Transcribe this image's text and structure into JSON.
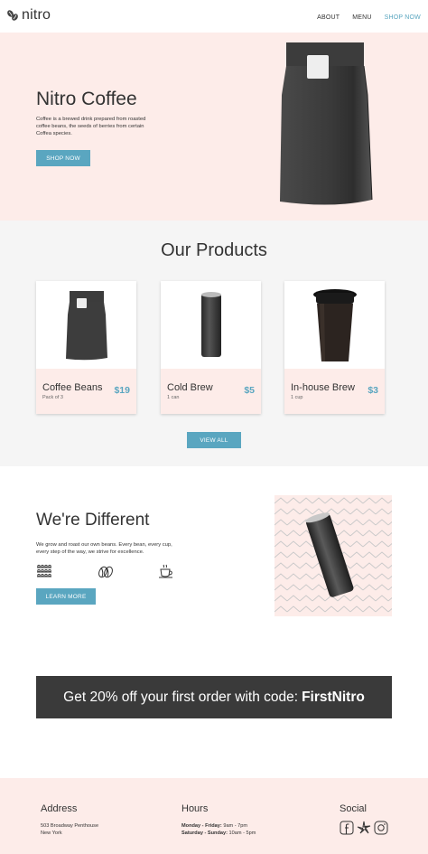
{
  "brand": {
    "name": "nitro"
  },
  "nav": {
    "items": [
      "ABOUT",
      "MENU",
      "SHOP NOW"
    ],
    "active_index": 2
  },
  "hero": {
    "title": "Nitro Coffee",
    "description": "Coffee is a brewed drink prepared from roasted coffee beans, the seeds of berries from certain Coffea species.",
    "button": "SHOP NOW"
  },
  "products": {
    "title": "Our Products",
    "items": [
      {
        "name": "Coffee Beans",
        "sub": "Pack of 3",
        "price": "$19",
        "icon": "coffee-bag-icon"
      },
      {
        "name": "Cold Brew",
        "sub": "1 can",
        "price": "$5",
        "icon": "coffee-can-icon"
      },
      {
        "name": "In-house Brew",
        "sub": "1 cup",
        "price": "$3",
        "icon": "coffee-cup-icon"
      }
    ],
    "button": "VIEW ALL"
  },
  "different": {
    "title": "We're Different",
    "description": "We grow and roast our own beans. Every bean, every cup, every step of the way, we strive for excellence.",
    "icons": [
      "coffee-plant-icon",
      "coffee-beans-icon",
      "coffee-mug-icon"
    ],
    "button": "LEARN MORE"
  },
  "promo": {
    "text": "Get 20% off your first order with code:",
    "code": "FirstNitro"
  },
  "footer": {
    "address": {
      "title": "Address",
      "line1": "503 Broadway Penthouse",
      "line2": "New York"
    },
    "hours": {
      "title": "Hours",
      "row1_label": "Monday - Friday:",
      "row1_value": "9am - 7pm",
      "row2_label": "Saturday - Sunday:",
      "row2_value": "10am - 5pm"
    },
    "social": {
      "title": "Social",
      "icons": [
        "facebook-icon",
        "yelp-icon",
        "instagram-icon"
      ]
    }
  },
  "colors": {
    "accent": "#5aa6c0",
    "blush": "#fdece9",
    "dark": "#3a3a3a",
    "grey_bg": "#f5f5f5"
  }
}
